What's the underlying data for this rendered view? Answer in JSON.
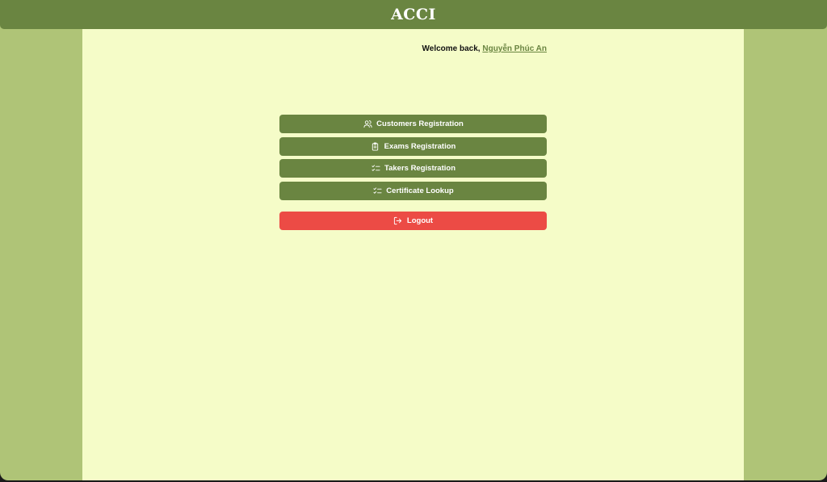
{
  "header": {
    "title": "ACCI"
  },
  "welcome": {
    "prefix": "Welcome back,",
    "user_name": "Nguyễn Phúc An"
  },
  "menu": {
    "items": [
      {
        "label": "Customers Registration",
        "icon": "users-icon"
      },
      {
        "label": "Exams Registration",
        "icon": "clipboard-icon"
      },
      {
        "label": "Takers Registration",
        "icon": "list-checks-icon"
      },
      {
        "label": "Certificate Lookup",
        "icon": "list-checks-icon"
      }
    ]
  },
  "logout": {
    "label": "Logout",
    "icon": "logout-icon"
  },
  "colors": {
    "header": "#6a8541",
    "side_panel": "#afc477",
    "content_bg": "#f5fcc8",
    "button": "#6a8541",
    "logout": "#ec4b45"
  }
}
